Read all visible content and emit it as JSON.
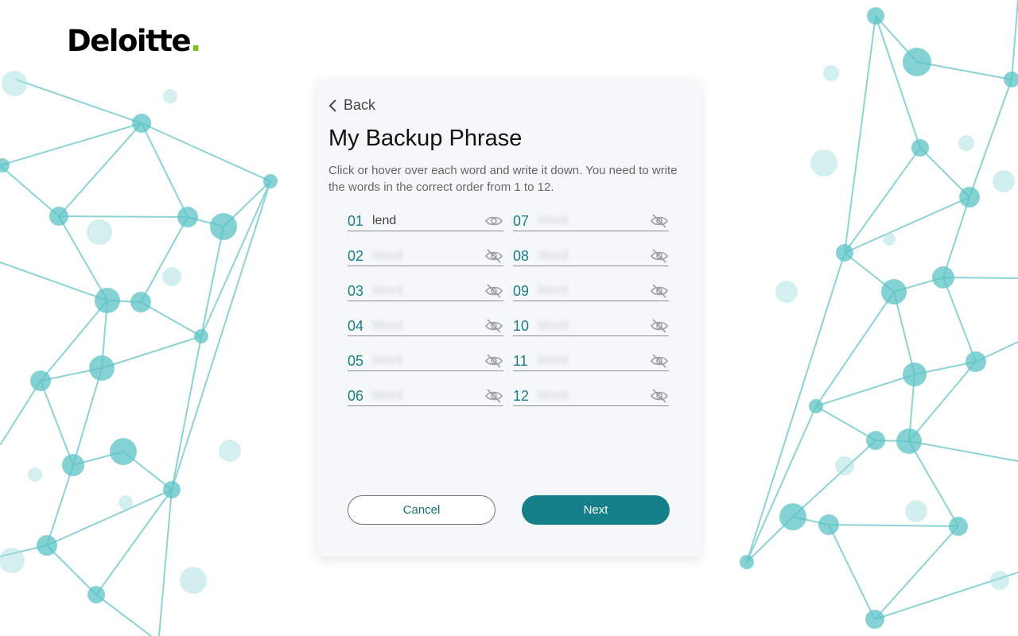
{
  "brand": {
    "logo_text": "Deloitte",
    "logo_dot": ".",
    "accent": "#86bc25"
  },
  "header": {
    "back_label": "Back",
    "title": "My Backup Phrase",
    "description": "Click or hover over each word and write it down. You need to write the words in the correct order from 1 to 12."
  },
  "words": [
    {
      "num": "01",
      "word": "lend",
      "visible": true
    },
    {
      "num": "02",
      "word": "Word",
      "visible": false
    },
    {
      "num": "03",
      "word": "Word",
      "visible": false
    },
    {
      "num": "04",
      "word": "Word",
      "visible": false
    },
    {
      "num": "05",
      "word": "Word",
      "visible": false
    },
    {
      "num": "06",
      "word": "Word",
      "visible": false
    },
    {
      "num": "07",
      "word": "Word",
      "visible": false
    },
    {
      "num": "08",
      "word": "Word",
      "visible": false
    },
    {
      "num": "09",
      "word": "Word",
      "visible": false
    },
    {
      "num": "10",
      "word": "Word",
      "visible": false
    },
    {
      "num": "11",
      "word": "Word",
      "visible": false
    },
    {
      "num": "12",
      "word": "Word",
      "visible": false
    }
  ],
  "actions": {
    "cancel_label": "Cancel",
    "next_label": "Next"
  },
  "colors": {
    "teal": "#147f89",
    "network": "#5cc3c6"
  }
}
